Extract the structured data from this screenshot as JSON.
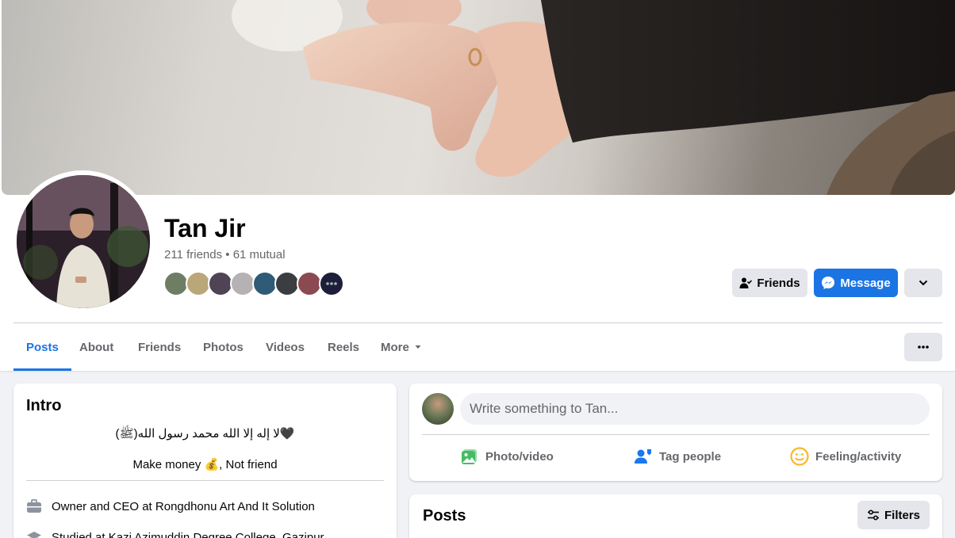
{
  "profile": {
    "name": "Tan Jir",
    "friends_summary": "211 friends • 61 mutual",
    "mutual_avatar_colors": [
      "#6f7d65",
      "#b9a77a",
      "#4f4356",
      "#b6b1b3",
      "#2f5b76",
      "#3b3d40",
      "#8b4a52",
      "#1d1e3a"
    ]
  },
  "actions": {
    "friends_label": "Friends",
    "message_label": "Message"
  },
  "tabs": [
    {
      "label": "Posts",
      "active": true
    },
    {
      "label": "About"
    },
    {
      "label": "Friends"
    },
    {
      "label": "Photos"
    },
    {
      "label": "Videos"
    },
    {
      "label": "Reels"
    },
    {
      "label": "More"
    }
  ],
  "intro": {
    "title": "Intro",
    "bio_line1": "لا إله إلا الله محمد رسول الله(ﷺ)🖤",
    "bio_line2": "Make money 💰, Not friend",
    "work": "Owner and CEO at Rongdhonu Art And It Solution",
    "education": "Studied at Kazi Azimuddin Degree College, Gazipur"
  },
  "composer": {
    "placeholder": "Write something to Tan...",
    "photo_video": "Photo/video",
    "tag_people": "Tag people",
    "feeling": "Feeling/activity"
  },
  "posts": {
    "title": "Posts",
    "filters_label": "Filters"
  },
  "colors": {
    "accent": "#1b74e4",
    "muted_text": "#65676b",
    "gray_button": "#e4e6eb",
    "photo_green": "#45bd62",
    "tag_blue": "#1877f2",
    "feeling_yellow": "#f7b928"
  }
}
